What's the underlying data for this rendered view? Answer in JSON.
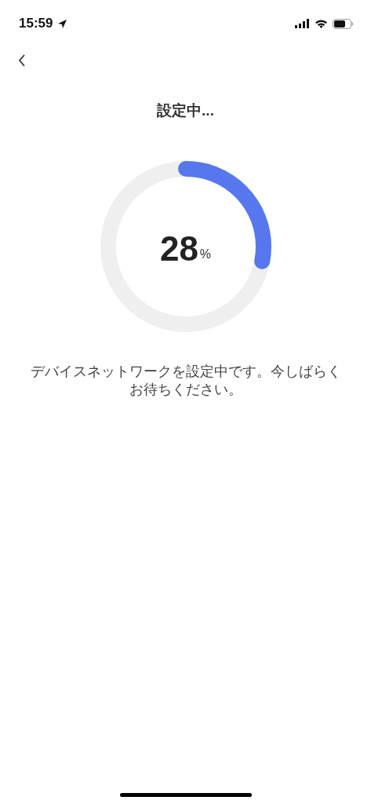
{
  "status_bar": {
    "time": "15:59"
  },
  "title": "設定中...",
  "progress": {
    "value": "28",
    "unit": "%"
  },
  "message": "デバイスネットワークを設定中です。今しばらくお待ちください。"
}
